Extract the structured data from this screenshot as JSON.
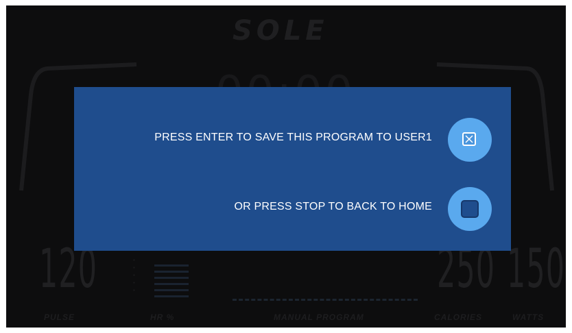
{
  "console": {
    "logo": "SOLE",
    "time_display": "00:00",
    "metrics": {
      "pulse": {
        "value": "120",
        "label": "PULSE"
      },
      "hr_percent": {
        "label": "HR %"
      },
      "program": {
        "label": "MANUAL PROGRAM"
      },
      "calories": {
        "value": "250",
        "label": "CALORIES"
      },
      "watts": {
        "value": "150",
        "label": "WATTS"
      }
    }
  },
  "dialog": {
    "save_message": "PRESS ENTER TO SAVE THIS PROGRAM TO USER1",
    "stop_message": "OR PRESS STOP TO BACK TO HOME",
    "enter_icon": "enter-x-icon",
    "stop_icon": "stop-square-icon"
  },
  "colors": {
    "dialog_background": "#1f4d8d",
    "button_circle": "#5aa9ee",
    "screen_background": "#0d0d0e"
  }
}
